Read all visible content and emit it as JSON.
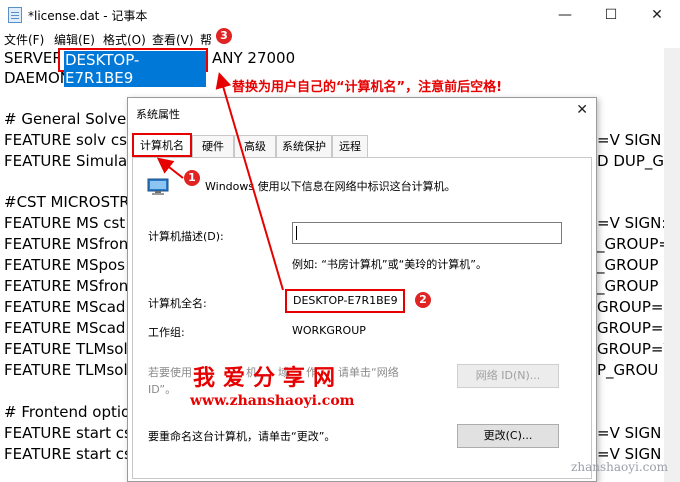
{
  "window": {
    "title": "*license.dat - 记事本",
    "controls": {
      "minimize": "—",
      "maximize": "☐",
      "close": "✕"
    }
  },
  "menu": [
    "文件(F)",
    "编辑(E)",
    "格式(O)",
    "查看(V)",
    "帮"
  ],
  "editor": {
    "lines": [
      "SERVER",
      "DAEMON cstd",
      "",
      "# General Solver",
      "FEATURE solv cst",
      "FEATURE Simulat",
      "",
      "#CST MICROSTR",
      "FEATURE MS cst",
      "FEATURE MSfron",
      "FEATURE MSpos",
      "FEATURE MSfron",
      "FEATURE MScad",
      "FEATURE MScad",
      "FEATURE TLMsol",
      "FEATURE TLMsol",
      "",
      "# Frontend optio",
      "FEATURE start cs",
      "FEATURE start cs"
    ],
    "server_tail": "ANY 27000",
    "hostname": "DESKTOP-E7R1BE9",
    "right_fragments": [
      "=V SIGN",
      "D DUP_G",
      "=V SIGN:",
      "_GROUP=",
      "_GROUP",
      "_GROUP",
      "GROUP=",
      "GROUP=",
      "GROUP=V",
      "P_GROU",
      "=V SIGN",
      "=V SIGN"
    ]
  },
  "annotation_text": "替换为用户自己的“计算机名”，注意前后空格!",
  "badges": [
    "1",
    "2",
    "3"
  ],
  "dialog": {
    "title": "系统属性",
    "close": "✕",
    "tabs": [
      "计算机名",
      "硬件",
      "高级",
      "系统保护",
      "远程"
    ],
    "active_tab": 0,
    "intro": "Windows 使用以下信息在网络中标识这台计算机。",
    "description_label": "计算机描述(D):",
    "description_value": "",
    "example": "例如: “书房计算机”或“美玲的计算机”。",
    "fullname_label": "计算机全名:",
    "fullname_value": "DESKTOP-E7R1BE9",
    "workgroup_label": "工作组:",
    "workgroup_value": "WORKGROUP",
    "domain_text_1": "若要使用",
    "domain_text_1b": "机",
    "domain_text_1c": "域",
    "domain_text_1d": "作",
    "domain_text_1e": "请单击“网络",
    "domain_text_2": "ID”。",
    "network_id_button": "网络 ID(N)...",
    "rename_text": "要重命名这台计算机，请单击“更改”。",
    "change_button": "更改(C)..."
  },
  "watermark": {
    "cn": "我爱分享网",
    "url": "www.zhanshaoyi.com",
    "corner": "zhanshaoyi.com"
  },
  "colors": {
    "accent_red": "#e60000",
    "selection": "#0078d7"
  },
  "icons": [
    "notepad-icon",
    "computer-icon"
  ]
}
